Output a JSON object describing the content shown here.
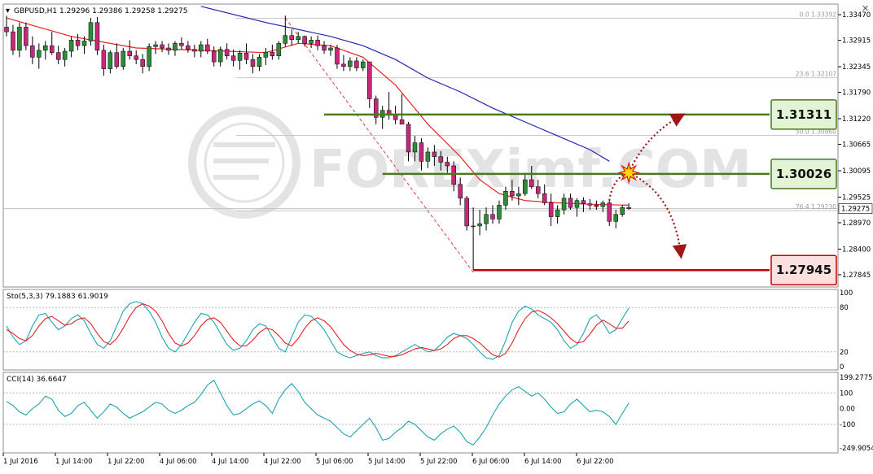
{
  "window": {
    "symbol_line": "GBPUSD,H1  1.29296 1.29386 1.29258 1.29275",
    "close_glyph": "✕"
  },
  "colors": {
    "bull_candle": "#2e8b3a",
    "bear_candle": "#c8287a",
    "ema_fast": "#e32222",
    "ema_slow": "#2424b4",
    "level_green": "#4a7a1e",
    "level_red": "#c40000",
    "box_green_fill": "#e3f4d6",
    "box_red_fill": "#ffdfe0",
    "stoch_main": "#1fa3b3",
    "stoch_signal": "#e32222",
    "cci_line": "#1fa3b3",
    "burst": "#ffd800"
  },
  "chart_data": {
    "type": "candlestick",
    "symbol": "GBPUSD",
    "timeframe": "H1",
    "ohlc_header": {
      "open": 1.29296,
      "high": 1.29386,
      "low": 1.29258,
      "close": 1.29275
    },
    "price_axis": {
      "range": [
        1.2758,
        1.337
      ],
      "ticks": [
        "1.33470",
        "1.32915",
        "1.32345",
        "1.31790",
        "1.31220",
        "1.30665",
        "1.30095",
        "1.29525",
        "1.28970",
        "1.28400",
        "1.27845"
      ],
      "current_price": "1.29275"
    },
    "time_axis": [
      "1 Jul 2016",
      "1 Jul 14:00",
      "1 Jul 22:00",
      "4 Jul 06:00",
      "4 Jul 14:00",
      "4 Jul 22:00",
      "5 Jul 06:00",
      "5 Jul 14:00",
      "5 Jul 22:00",
      "6 Jul 06:00",
      "6 Jul 14:00",
      "6 Jul 22:00"
    ],
    "candles": [
      [
        1.332,
        1.3345,
        1.33,
        1.331
      ],
      [
        1.331,
        1.3325,
        1.326,
        1.327
      ],
      [
        1.327,
        1.333,
        1.3255,
        1.332
      ],
      [
        1.332,
        1.333,
        1.327,
        1.328
      ],
      [
        1.328,
        1.33,
        1.324,
        1.3255
      ],
      [
        1.3255,
        1.3285,
        1.323,
        1.327
      ],
      [
        1.327,
        1.329,
        1.325,
        1.328
      ],
      [
        1.328,
        1.331,
        1.326,
        1.3265
      ],
      [
        1.3265,
        1.328,
        1.324,
        1.325
      ],
      [
        1.325,
        1.3275,
        1.3235,
        1.3268
      ],
      [
        1.3268,
        1.33,
        1.3255,
        1.3292
      ],
      [
        1.3292,
        1.3305,
        1.327,
        1.328
      ],
      [
        1.328,
        1.33,
        1.3262,
        1.329
      ],
      [
        1.329,
        1.334,
        1.328,
        1.333
      ],
      [
        1.333,
        1.3342,
        1.326,
        1.327
      ],
      [
        1.327,
        1.3282,
        1.3215,
        1.323
      ],
      [
        1.323,
        1.327,
        1.322,
        1.3265
      ],
      [
        1.3265,
        1.3285,
        1.323,
        1.3235
      ],
      [
        1.3235,
        1.3275,
        1.3228,
        1.3268
      ],
      [
        1.3268,
        1.3292,
        1.325,
        1.3258
      ],
      [
        1.3258,
        1.327,
        1.324,
        1.325
      ],
      [
        1.325,
        1.3262,
        1.322,
        1.3235
      ],
      [
        1.3235,
        1.3285,
        1.3225,
        1.3278
      ],
      [
        1.3278,
        1.329,
        1.3262,
        1.3282
      ],
      [
        1.3282,
        1.329,
        1.3266,
        1.3275
      ],
      [
        1.3275,
        1.3285,
        1.326,
        1.327
      ],
      [
        1.327,
        1.329,
        1.3258,
        1.3285
      ],
      [
        1.3285,
        1.3298,
        1.3272,
        1.328
      ],
      [
        1.328,
        1.329,
        1.3265,
        1.3272
      ],
      [
        1.3272,
        1.3282,
        1.3255,
        1.3268
      ],
      [
        1.3268,
        1.329,
        1.3255,
        1.3282
      ],
      [
        1.3282,
        1.3295,
        1.3262,
        1.3268
      ],
      [
        1.3268,
        1.3278,
        1.3235,
        1.3245
      ],
      [
        1.3245,
        1.3278,
        1.3235,
        1.3272
      ],
      [
        1.3272,
        1.3285,
        1.325,
        1.3258
      ],
      [
        1.3258,
        1.3272,
        1.3235,
        1.3248
      ],
      [
        1.3248,
        1.327,
        1.3228,
        1.3264
      ],
      [
        1.3264,
        1.3285,
        1.324,
        1.325
      ],
      [
        1.325,
        1.3262,
        1.322,
        1.3235
      ],
      [
        1.3235,
        1.3262,
        1.3225,
        1.3255
      ],
      [
        1.3255,
        1.3275,
        1.3238,
        1.3266
      ],
      [
        1.3266,
        1.3282,
        1.325,
        1.3258
      ],
      [
        1.3258,
        1.329,
        1.325,
        1.3285
      ],
      [
        1.3285,
        1.3345,
        1.3278,
        1.3302
      ],
      [
        1.3302,
        1.3315,
        1.328,
        1.3293
      ],
      [
        1.3293,
        1.331,
        1.3285,
        1.33
      ],
      [
        1.33,
        1.3302,
        1.3278,
        1.3285
      ],
      [
        1.3285,
        1.33,
        1.3275,
        1.3292
      ],
      [
        1.3292,
        1.3302,
        1.327,
        1.328
      ],
      [
        1.328,
        1.329,
        1.3262,
        1.327
      ],
      [
        1.327,
        1.3282,
        1.3258,
        1.3275
      ],
      [
        1.3275,
        1.3282,
        1.323,
        1.324
      ],
      [
        1.324,
        1.326,
        1.3225,
        1.3235
      ],
      [
        1.3235,
        1.3255,
        1.3225,
        1.3247
      ],
      [
        1.3247,
        1.3255,
        1.3225,
        1.3232
      ],
      [
        1.3232,
        1.325,
        1.3225,
        1.3245
      ],
      [
        1.3245,
        1.3245,
        1.3145,
        1.3165
      ],
      [
        1.3165,
        1.3172,
        1.311,
        1.3125
      ],
      [
        1.3125,
        1.315,
        1.31,
        1.314
      ],
      [
        1.314,
        1.318,
        1.312,
        1.313
      ],
      [
        1.313,
        1.315,
        1.311,
        1.312
      ],
      [
        1.312,
        1.3175,
        1.3115,
        1.311
      ],
      [
        1.311,
        1.3115,
        1.303,
        1.305
      ],
      [
        1.305,
        1.3085,
        1.303,
        1.307
      ],
      [
        1.307,
        1.308,
        1.301,
        1.303
      ],
      [
        1.303,
        1.306,
        1.3015,
        1.305
      ],
      [
        1.305,
        1.3065,
        1.302,
        1.304
      ],
      [
        1.304,
        1.3052,
        1.301,
        1.3028
      ],
      [
        1.3028,
        1.304,
        1.3005,
        1.302
      ],
      [
        1.302,
        1.303,
        1.2965,
        1.298
      ],
      [
        1.298,
        1.2995,
        1.2935,
        1.295
      ],
      [
        1.295,
        1.2955,
        1.288,
        1.289
      ],
      [
        1.289,
        1.293,
        1.2795,
        1.289
      ],
      [
        1.289,
        1.2925,
        1.287,
        1.2895
      ],
      [
        1.2895,
        1.293,
        1.288,
        1.2915
      ],
      [
        1.2915,
        1.2935,
        1.2895,
        1.2905
      ],
      [
        1.2905,
        1.2945,
        1.2895,
        1.2935
      ],
      [
        1.2935,
        1.2975,
        1.2925,
        1.2965
      ],
      [
        1.2965,
        1.299,
        1.2945,
        1.2955
      ],
      [
        1.2955,
        1.2975,
        1.2935,
        1.296
      ],
      [
        1.296,
        1.3005,
        1.2955,
        1.299
      ],
      [
        1.299,
        1.302,
        1.297,
        1.2975
      ],
      [
        1.2975,
        1.299,
        1.295,
        1.296
      ],
      [
        1.296,
        1.298,
        1.2935,
        1.294
      ],
      [
        1.294,
        1.296,
        1.289,
        1.291
      ],
      [
        1.291,
        1.2935,
        1.2895,
        1.2925
      ],
      [
        1.2925,
        1.296,
        1.2915,
        1.295
      ],
      [
        1.295,
        1.296,
        1.2925,
        1.293
      ],
      [
        1.293,
        1.295,
        1.291,
        1.2945
      ],
      [
        1.2945,
        1.2952,
        1.292,
        1.2938
      ],
      [
        1.2938,
        1.2948,
        1.2925,
        1.2935
      ],
      [
        1.2935,
        1.2945,
        1.2925,
        1.2932
      ],
      [
        1.2932,
        1.2945,
        1.292,
        1.294
      ],
      [
        1.294,
        1.2945,
        1.289,
        1.29
      ],
      [
        1.29,
        1.2925,
        1.2885,
        1.2915
      ],
      [
        1.2915,
        1.2935,
        1.291,
        1.293
      ],
      [
        1.293,
        1.2939,
        1.2925,
        1.29275
      ]
    ],
    "ema_fast": [
      [
        0,
        1.334
      ],
      [
        10,
        1.33
      ],
      [
        20,
        1.3275
      ],
      [
        30,
        1.327
      ],
      [
        40,
        1.3265
      ],
      [
        45,
        1.3285
      ],
      [
        50,
        1.328
      ],
      [
        55,
        1.3255
      ],
      [
        60,
        1.3195
      ],
      [
        65,
        1.311
      ],
      [
        70,
        1.304
      ],
      [
        73,
        1.299
      ],
      [
        76,
        1.296
      ],
      [
        80,
        1.2945
      ],
      [
        85,
        1.294
      ],
      [
        90,
        1.2937
      ],
      [
        96,
        1.2935
      ]
    ],
    "ema_slow": [
      [
        30,
        1.3365
      ],
      [
        40,
        1.333
      ],
      [
        50,
        1.33
      ],
      [
        55,
        1.328
      ],
      [
        60,
        1.325
      ],
      [
        65,
        1.321
      ],
      [
        70,
        1.318
      ],
      [
        75,
        1.3145
      ],
      [
        80,
        1.3115
      ],
      [
        85,
        1.3085
      ],
      [
        90,
        1.3055
      ],
      [
        93,
        1.303
      ]
    ],
    "fibonacci": {
      "levels": [
        {
          "label": "0.0  1.33392",
          "price": 1.33392
        },
        {
          "label": "23.6  1.32107",
          "price": 1.32107
        },
        {
          "label": "50.0  1.30860",
          "price": 1.3086
        },
        {
          "label": "76.4  1.29230",
          "price": 1.2923
        }
      ],
      "trendline": {
        "from": [
          43,
          1.334
        ],
        "to": [
          72,
          1.279
        ]
      }
    },
    "levels": [
      {
        "label": "1.31311",
        "price": 1.31311,
        "from": 49,
        "kind": "resistance"
      },
      {
        "label": "1.30026",
        "price": 1.30026,
        "from": 58,
        "kind": "resistance"
      },
      {
        "label": "1.27945",
        "price": 1.27945,
        "from": 72,
        "kind": "support"
      }
    ],
    "scenario": {
      "breakout_point": [
        96,
        1.3005
      ],
      "up_target": [
        104,
        1.3128
      ],
      "down_target": [
        104,
        1.283
      ],
      "start": [
        93,
        1.2945
      ]
    },
    "stochastic": {
      "label": "Sto(5,3,3) 79.1883 61.9019",
      "range": [
        0,
        100
      ],
      "ticks": [
        "100",
        "80",
        "20",
        "0"
      ],
      "main": [
        55,
        40,
        30,
        35,
        55,
        70,
        72,
        60,
        50,
        55,
        65,
        70,
        62,
        45,
        30,
        25,
        35,
        55,
        75,
        85,
        88,
        85,
        75,
        60,
        40,
        25,
        20,
        30,
        45,
        60,
        72,
        70,
        60,
        45,
        30,
        22,
        25,
        35,
        50,
        58,
        55,
        40,
        25,
        20,
        40,
        60,
        70,
        68,
        60,
        50,
        35,
        20,
        15,
        12,
        15,
        18,
        20,
        15,
        12,
        12,
        15,
        20,
        25,
        30,
        25,
        20,
        22,
        30,
        40,
        45,
        42,
        38,
        30,
        20,
        12,
        10,
        15,
        35,
        60,
        75,
        82,
        78,
        70,
        65,
        60,
        50,
        35,
        25,
        30,
        45,
        65,
        70,
        60,
        45,
        50,
        65,
        79.1883
      ],
      "signal": [
        50,
        45,
        38,
        35,
        42,
        55,
        65,
        68,
        62,
        56,
        58,
        64,
        66,
        58,
        45,
        34,
        30,
        38,
        52,
        68,
        80,
        85,
        82,
        75,
        62,
        45,
        32,
        28,
        32,
        42,
        55,
        64,
        66,
        60,
        48,
        36,
        28,
        28,
        36,
        46,
        52,
        50,
        42,
        32,
        28,
        38,
        52,
        62,
        66,
        62,
        54,
        42,
        30,
        22,
        17,
        15,
        16,
        18,
        16,
        14,
        14,
        16,
        20,
        24,
        26,
        24,
        22,
        24,
        30,
        38,
        42,
        42,
        38,
        32,
        24,
        16,
        13,
        18,
        32,
        50,
        65,
        74,
        76,
        72,
        66,
        58,
        48,
        38,
        32,
        34,
        44,
        56,
        63,
        58,
        52,
        52,
        61.9019
      ],
      "last_values": [
        79.1883,
        61.9019
      ]
    },
    "cci": {
      "label": "CCI(14) 36.6647",
      "range": [
        -260,
        210
      ],
      "ticks": [
        "199.2775",
        "100",
        "0.00",
        "-100",
        "-249.9054"
      ],
      "values": [
        45,
        20,
        -20,
        -40,
        0,
        30,
        80,
        60,
        -10,
        -50,
        -30,
        20,
        40,
        -10,
        -60,
        -20,
        30,
        10,
        -30,
        -60,
        -40,
        -20,
        10,
        40,
        30,
        -10,
        -30,
        -10,
        20,
        40,
        90,
        150,
        180,
        100,
        20,
        -40,
        -30,
        0,
        30,
        50,
        20,
        -30,
        60,
        120,
        160,
        110,
        40,
        0,
        -40,
        -60,
        -80,
        -120,
        -160,
        -180,
        -140,
        -100,
        -60,
        -120,
        -200,
        -190,
        -150,
        -120,
        -80,
        -100,
        -140,
        -180,
        -200,
        -160,
        -130,
        -110,
        -150,
        -210,
        -230,
        -180,
        -120,
        -40,
        30,
        80,
        120,
        140,
        110,
        80,
        100,
        60,
        10,
        -30,
        -20,
        30,
        60,
        20,
        -20,
        -10,
        -20,
        -50,
        -100,
        -30,
        36.6647
      ]
    }
  },
  "watermark": {
    "brand": "FOREXimf.COM"
  }
}
